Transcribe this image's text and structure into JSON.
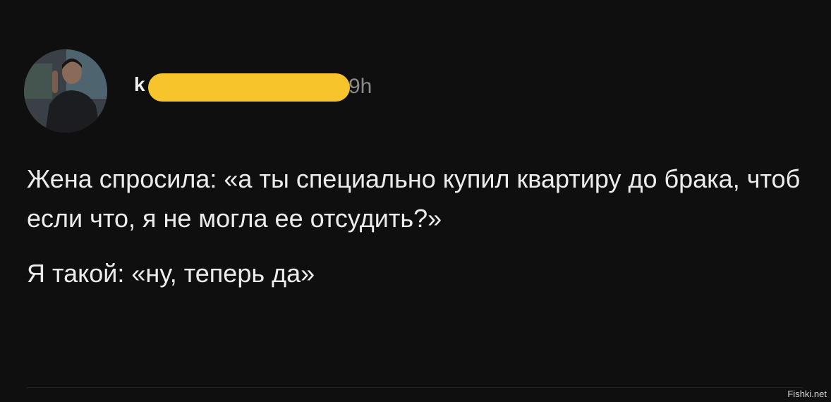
{
  "post": {
    "username_visible": "k",
    "timestamp": "9h",
    "paragraphs": [
      "Жена спросила: «а ты специально купил квартиру до брака, чтоб если что, я не могла ее отсудить?»",
      "Я такой: «ну, теперь да»"
    ]
  },
  "watermark": "Fishki.net",
  "colors": {
    "background": "#0f0f10",
    "text": "#ececec",
    "timestamp": "#8a8a8a",
    "redaction": "#f7c52b"
  },
  "icons": {
    "avatar": "user-avatar-photo"
  }
}
